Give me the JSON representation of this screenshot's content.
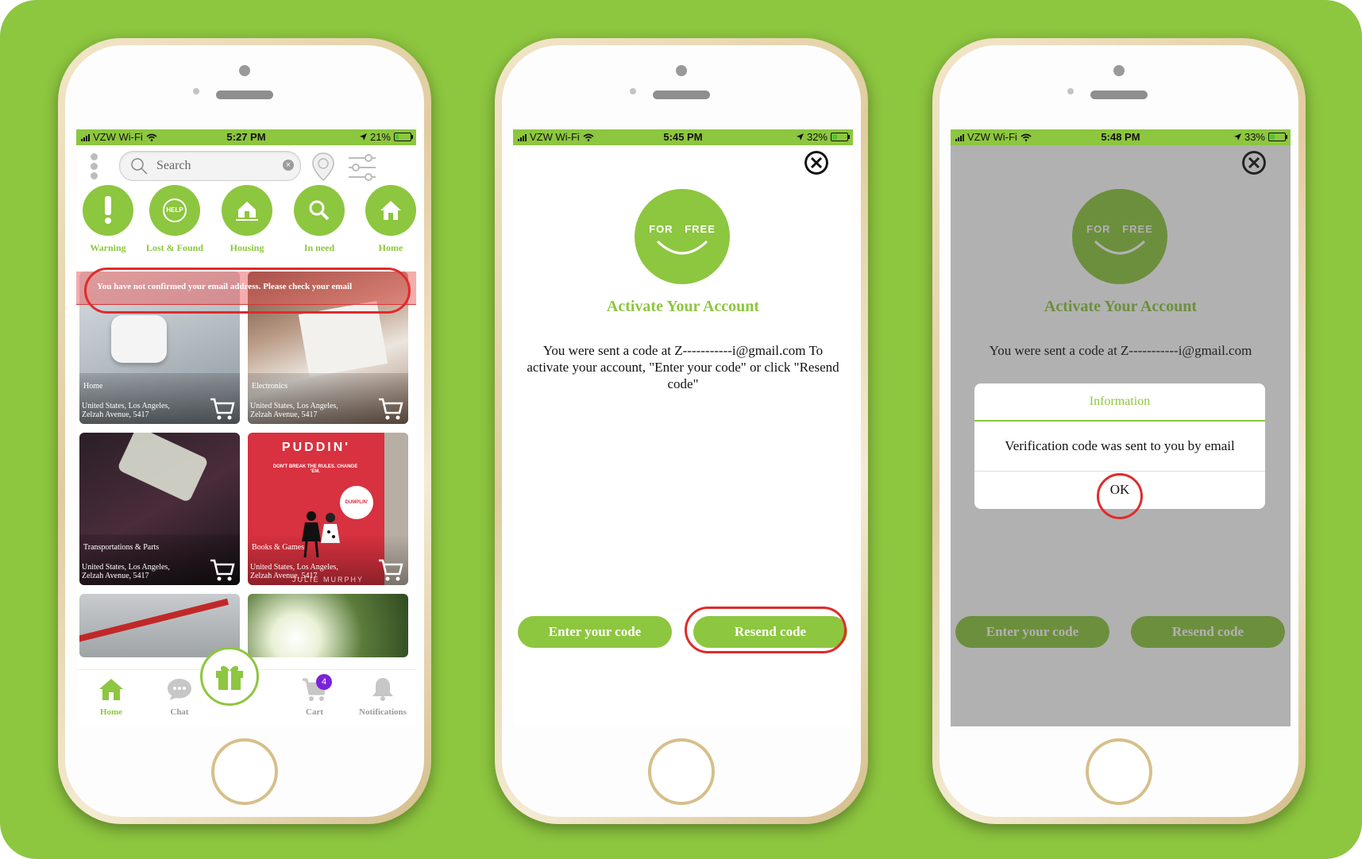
{
  "screen1": {
    "status": {
      "carrier": "VZW Wi-Fi",
      "time": "5:27 PM",
      "battery": "21%",
      "battery_level": 0.21
    },
    "search_placeholder": "Search",
    "categories": [
      {
        "label": "Warning",
        "icon": "exclamation-icon"
      },
      {
        "label": "Lost & Found",
        "icon": "help-sign-icon"
      },
      {
        "label": "Housing",
        "icon": "house-hand-icon"
      },
      {
        "label": "In need",
        "icon": "search-box-icon"
      },
      {
        "label": "Home",
        "icon": "house-icon"
      }
    ],
    "banner": "You have not confirmed your email address. Please check your email",
    "listings": [
      {
        "category": "Home",
        "location": "United States, Los Angeles, Zelzah Avenue, 5417"
      },
      {
        "category": "Electronics",
        "location": "United States, Los Angeles, Zelzah Avenue, 5417"
      },
      {
        "category": "Transportations & Parts",
        "location": "United States, Los Angeles, Zelzah Avenue, 5417"
      },
      {
        "category": "Books & Games",
        "location": "United States, Los Angeles, Zelzah Avenue, 5417"
      }
    ],
    "book": {
      "title": "PUDDIN'",
      "tagline": "DON'T BREAK THE RULES. CHANGE 'EM.",
      "sticker": "DUMPLIN'",
      "author": "JULIE MURPHY"
    },
    "tabs": [
      {
        "label": "Home",
        "icon": "home-icon"
      },
      {
        "label": "Chat",
        "icon": "chat-bubble-icon"
      },
      {
        "label": "Cart",
        "icon": "cart-icon"
      },
      {
        "label": "Notifications",
        "icon": "bell-icon"
      }
    ],
    "cart_count": "4"
  },
  "screen2": {
    "status": {
      "carrier": "VZW Wi-Fi",
      "time": "5:45 PM",
      "battery": "32%",
      "battery_level": 0.32
    },
    "logo": {
      "left": "FOR",
      "right": "FREE"
    },
    "title": "Activate Your Account",
    "message": "You were sent a code at Z-----------i@gmail.com To activate your account, \"Enter your code\" or click \"Resend code\"",
    "enter_code": "Enter your code",
    "resend_code": "Resend code"
  },
  "screen3": {
    "status": {
      "carrier": "VZW Wi-Fi",
      "time": "5:48 PM",
      "battery": "33%",
      "battery_level": 0.33
    },
    "logo": {
      "left": "FOR",
      "right": "FREE"
    },
    "title": "Activate Your Account",
    "message_line1": "You were sent a code at Z-----------i@gmail.com",
    "enter_code": "Enter your code",
    "resend_code": "Resend code",
    "dialog": {
      "title": "Information",
      "message": "Verification code was sent to you by email",
      "ok": "OK"
    }
  },
  "colors": {
    "brand": "#8dc63f",
    "highlight": "#e02b2b",
    "badge": "#7a22d9"
  }
}
